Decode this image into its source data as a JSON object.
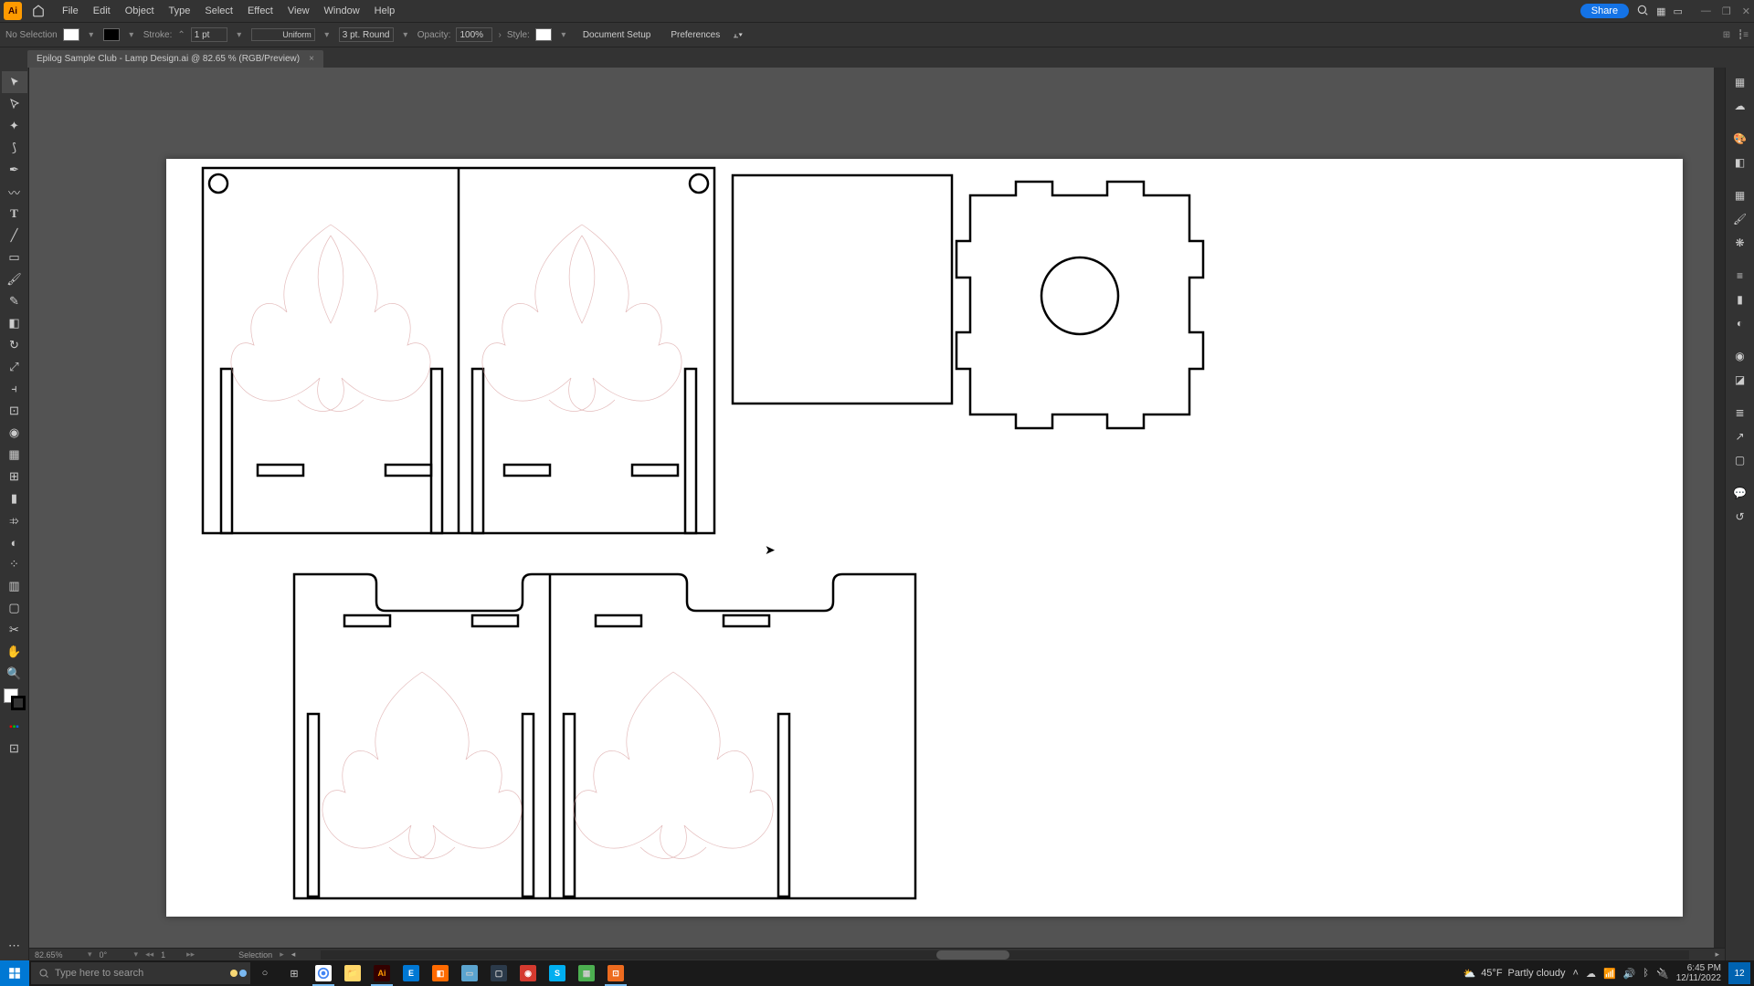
{
  "app": {
    "short": "Ai"
  },
  "menu": {
    "file": "File",
    "edit": "Edit",
    "object": "Object",
    "type": "Type",
    "select": "Select",
    "effect": "Effect",
    "view": "View",
    "window": "Window",
    "help": "Help"
  },
  "menubar_right": {
    "share": "Share"
  },
  "controlbar": {
    "selection_status": "No Selection",
    "stroke_label": "Stroke:",
    "stroke_weight": "1 pt",
    "profile": "Uniform",
    "brush": "3 pt. Round",
    "opacity_label": "Opacity:",
    "opacity_value": "100%",
    "style_label": "Style:",
    "doc_setup": "Document Setup",
    "preferences": "Preferences"
  },
  "tab": {
    "title": "Epilog Sample Club - Lamp Design.ai @ 82.65 % (RGB/Preview)",
    "close": "×"
  },
  "statusbar": {
    "zoom": "82.65%",
    "rotate": "0°",
    "artboard_nav": "1",
    "tool_hint": "Selection"
  },
  "taskbar": {
    "search_placeholder": "Type here to search",
    "weather_temp": "45°F",
    "weather_cond": "Partly cloudy",
    "time": "6:45 PM",
    "date": "12/11/2022",
    "notif_count": "12"
  },
  "colors": {
    "accent_blue": "#1473e6",
    "panel_bg": "#333333",
    "canvas_bg": "#535353"
  }
}
